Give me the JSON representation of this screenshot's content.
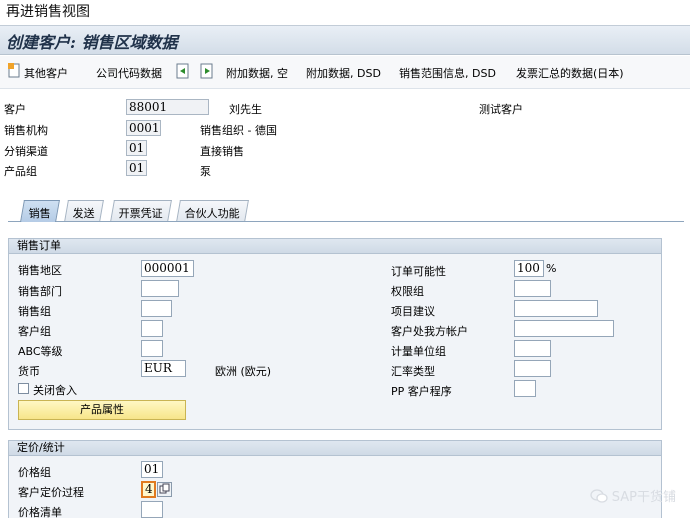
{
  "caption": "再进销售视图",
  "title": "创建客户: 销售区域数据",
  "toolbar": {
    "other_customer": "其他客户",
    "company_code_data": "公司代码数据",
    "additional_data_empty": "附加数据, 空",
    "additional_data_dsd": "附加数据, DSD",
    "sales_area_info": "销售范围信息, DSD",
    "invoice_summary": "发票汇总的数据(日本)"
  },
  "header": {
    "customer_label": "客户",
    "customer_value": "88001",
    "customer_name": "刘先生",
    "customer_desc": "测试客户",
    "sales_org_label": "销售机构",
    "sales_org_value": "0001",
    "sales_org_desc": "销售组织 - 德国",
    "dist_channel_label": "分销渠道",
    "dist_channel_value": "01",
    "dist_channel_desc": "直接销售",
    "division_label": "产品组",
    "division_value": "01",
    "division_desc": "泵"
  },
  "tabs": [
    "销售",
    "发送",
    "开票凭证",
    "合伙人功能"
  ],
  "sales_order": {
    "title": "销售订单",
    "sales_district_label": "销售地区",
    "sales_district_value": "000001",
    "sales_office_label": "销售部门",
    "sales_group_label": "销售组",
    "customer_group_label": "客户组",
    "abc_class_label": "ABC等级",
    "currency_label": "货币",
    "currency_value": "EUR",
    "currency_desc": "欧洲 (欧元)",
    "close_rounding_label": "关闭舍入",
    "product_attr_button": "产品属性",
    "order_probability_label": "订单可能性",
    "order_probability_value": "100",
    "order_probability_unit": "%",
    "auth_group_label": "权限组",
    "item_proposal_label": "项目建议",
    "account_at_customer_label": "客户处我方帐户",
    "uom_group_label": "计量单位组",
    "exchange_rate_type_label": "汇率类型",
    "pp_customer_proc_label": "PP 客户程序"
  },
  "pricing": {
    "title": "定价/统计",
    "price_group_label": "价格组",
    "price_group_value": "01",
    "cust_pricing_proc_label": "客户定价过程",
    "cust_pricing_proc_value": "4",
    "price_list_label": "价格清单"
  },
  "watermark": "SAP干货铺"
}
